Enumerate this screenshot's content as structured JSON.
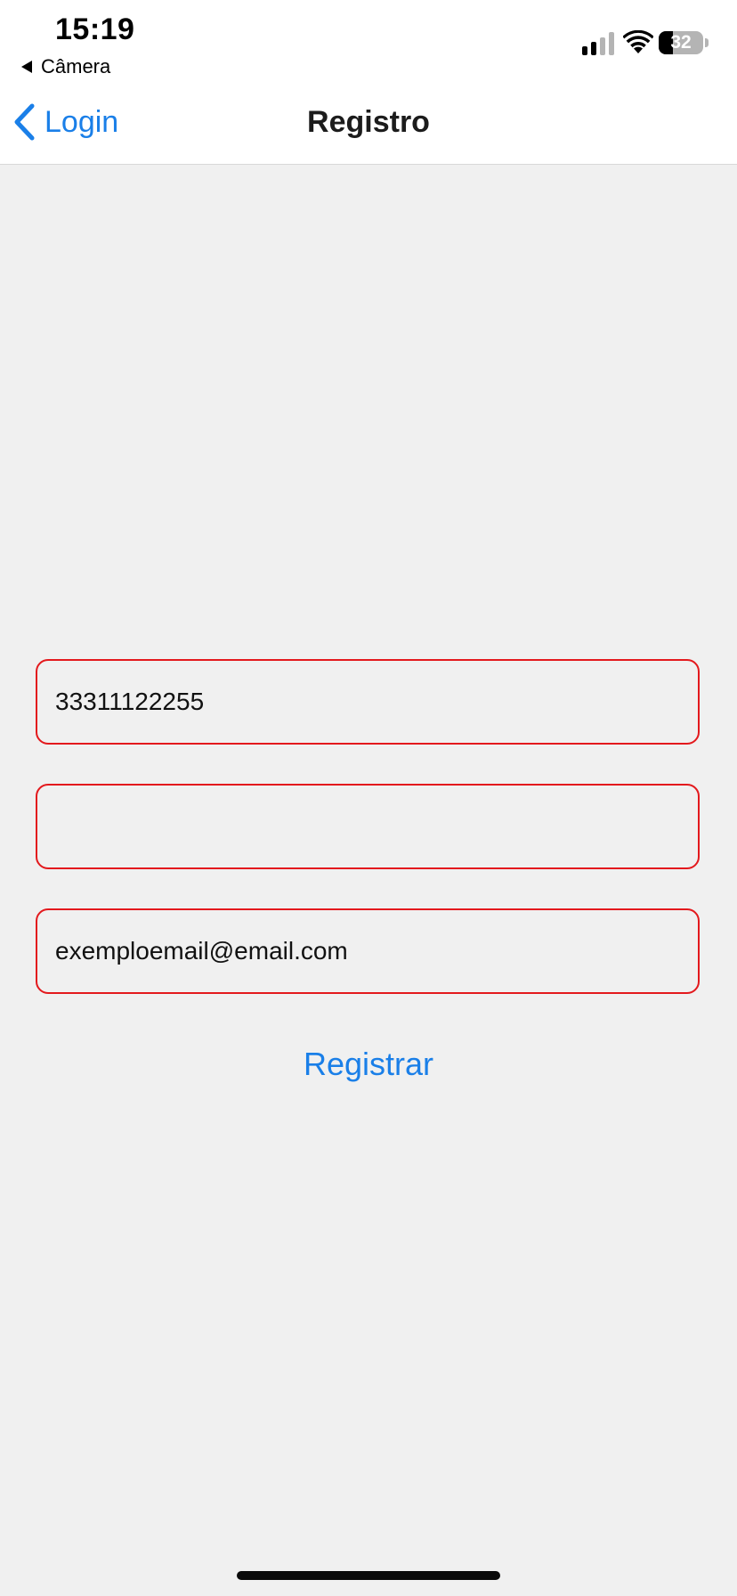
{
  "status_bar": {
    "time": "15:19",
    "back_app_label": "Câmera",
    "battery_percent": "32",
    "battery_level": 0.32,
    "signal_bars_active": 2,
    "signal_bars_total": 4,
    "icons": [
      "cellular-signal-icon",
      "wifi-icon",
      "battery-icon"
    ]
  },
  "nav": {
    "back_label": "Login",
    "back_icon": "chevron-left-icon",
    "title": "Registro"
  },
  "form": {
    "fields": [
      {
        "value": "33311122255",
        "placeholder": ""
      },
      {
        "value": "",
        "placeholder": ""
      },
      {
        "value": "exemploemail@email.com",
        "placeholder": ""
      }
    ],
    "submit_label": "Registrar"
  },
  "colors": {
    "accent": "#1a7fe8",
    "error_border": "#e3191d",
    "background": "#f0f0f0",
    "bar_background": "#ffffff"
  }
}
